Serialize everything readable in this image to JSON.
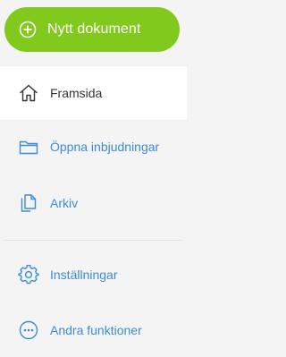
{
  "new_document": {
    "label": "Nytt dokument",
    "icon": "plus-circle-icon",
    "color": "#82c91e"
  },
  "nav": {
    "items": [
      {
        "label": "Framsida",
        "icon": "home-icon",
        "active": true
      },
      {
        "label": "Öppna inbjudningar",
        "icon": "folder-icon",
        "active": false
      },
      {
        "label": "Arkiv",
        "icon": "archive-icon",
        "active": false
      }
    ],
    "secondary": [
      {
        "label": "Inställningar",
        "icon": "gear-icon"
      },
      {
        "label": "Andra funktioner",
        "icon": "more-options-icon"
      }
    ]
  },
  "colors": {
    "accent": "#3b8bd6",
    "active_text": "#333333",
    "background": "#f4f4f4"
  }
}
